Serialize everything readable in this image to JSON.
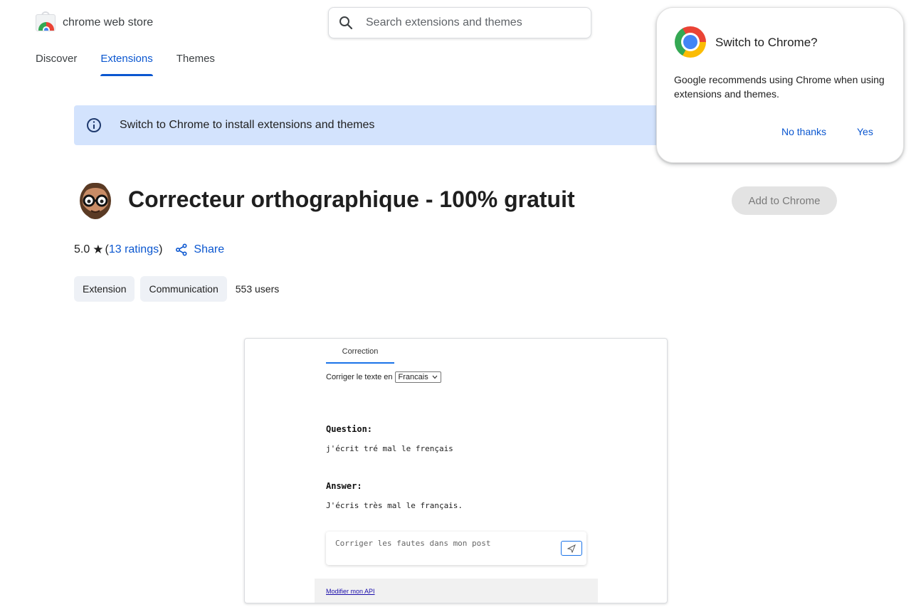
{
  "header": {
    "store_name": "chrome web store",
    "search_placeholder": "Search extensions and themes",
    "nav": [
      {
        "label": "Discover"
      },
      {
        "label": "Extensions"
      },
      {
        "label": "Themes"
      }
    ],
    "active_nav": "Extensions"
  },
  "banner": {
    "text": "Switch to Chrome to install extensions and themes"
  },
  "popup": {
    "title": "Switch to Chrome?",
    "body": "Google recommends using Chrome when using extensions and themes.",
    "no_label": "No thanks",
    "yes_label": "Yes"
  },
  "extension": {
    "title": "Correcteur orthographique - 100% gratuit",
    "add_button": "Add to Chrome",
    "rating_value": "5.0",
    "rating_star": "★",
    "ratings_open": "(",
    "ratings_link": "13 ratings",
    "ratings_close": ")",
    "share_label": "Share",
    "chips": [
      "Extension",
      "Communication"
    ],
    "users": "553 users"
  },
  "screenshot": {
    "tab_label": "Correction",
    "lang_label": "Corriger le texte en",
    "lang_value": "Francais",
    "question_label": "Question:",
    "question_text": "j'écrit tré mal le frençais",
    "answer_label": "Answer:",
    "answer_text": "J'écris très mal le français.",
    "input_placeholder": "Corriger les fautes dans mon post",
    "footer_link": "Modifier mon API"
  },
  "colors": {
    "accent": "#0b57d0",
    "banner_bg": "#d3e3fd",
    "chip_bg": "#eef1f6",
    "disabled_button_bg": "#e3e3e3"
  }
}
